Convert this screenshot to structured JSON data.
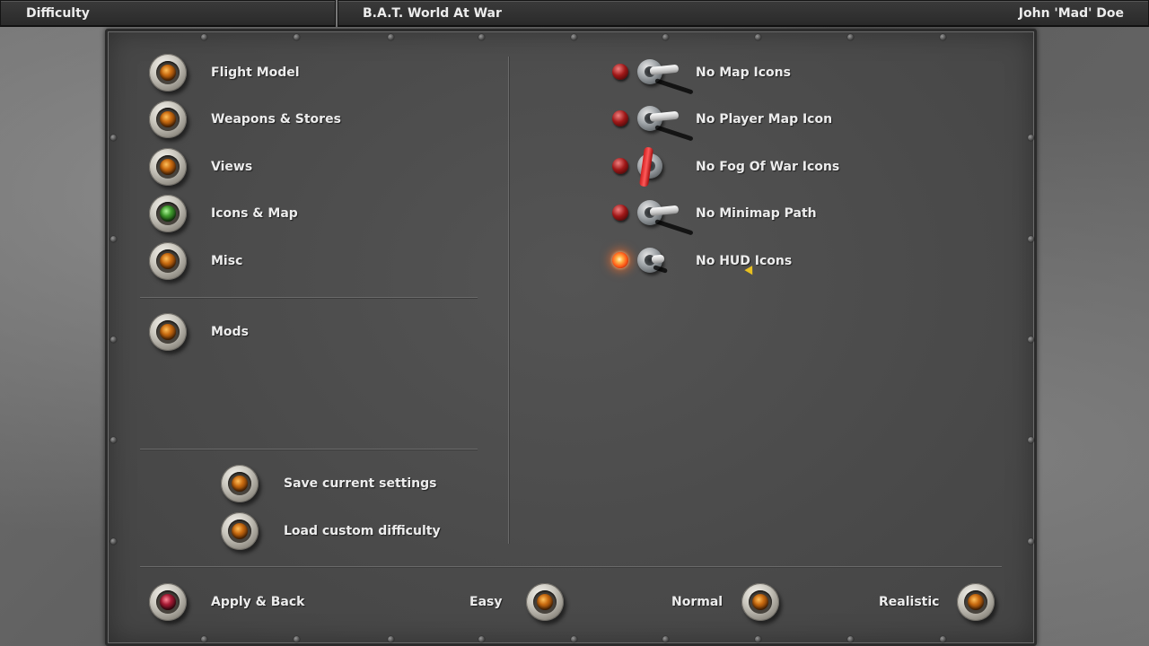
{
  "topbar": {
    "section": "Difficulty",
    "game_title": "B.A.T. World At War",
    "user": "John 'Mad' Doe"
  },
  "categories": [
    {
      "label": "Flight Model",
      "lamp": "amber"
    },
    {
      "label": "Weapons & Stores",
      "lamp": "amber"
    },
    {
      "label": "Views",
      "lamp": "amber"
    },
    {
      "label": "Icons & Map",
      "lamp": "green"
    },
    {
      "label": "Misc",
      "lamp": "amber"
    }
  ],
  "mods": {
    "label": "Mods",
    "lamp": "amber"
  },
  "actions": {
    "save": "Save current settings",
    "load": "Load custom difficulty"
  },
  "options": [
    {
      "label": "No Map Icons",
      "state": "off"
    },
    {
      "label": "No Player Map Icon",
      "state": "off"
    },
    {
      "label": "No Fog Of War Icons",
      "state": "mid"
    },
    {
      "label": "No Minimap Path",
      "state": "off"
    },
    {
      "label": "No HUD Icons",
      "state": "on"
    }
  ],
  "footer": {
    "apply_back": "Apply & Back",
    "easy": "Easy",
    "normal": "Normal",
    "realistic": "Realistic"
  },
  "colors": {
    "lamp_amber": "#c86a10",
    "lamp_green": "#3f9a2c",
    "lamp_red": "#a81b35",
    "led_on": "#ff5e1a"
  }
}
